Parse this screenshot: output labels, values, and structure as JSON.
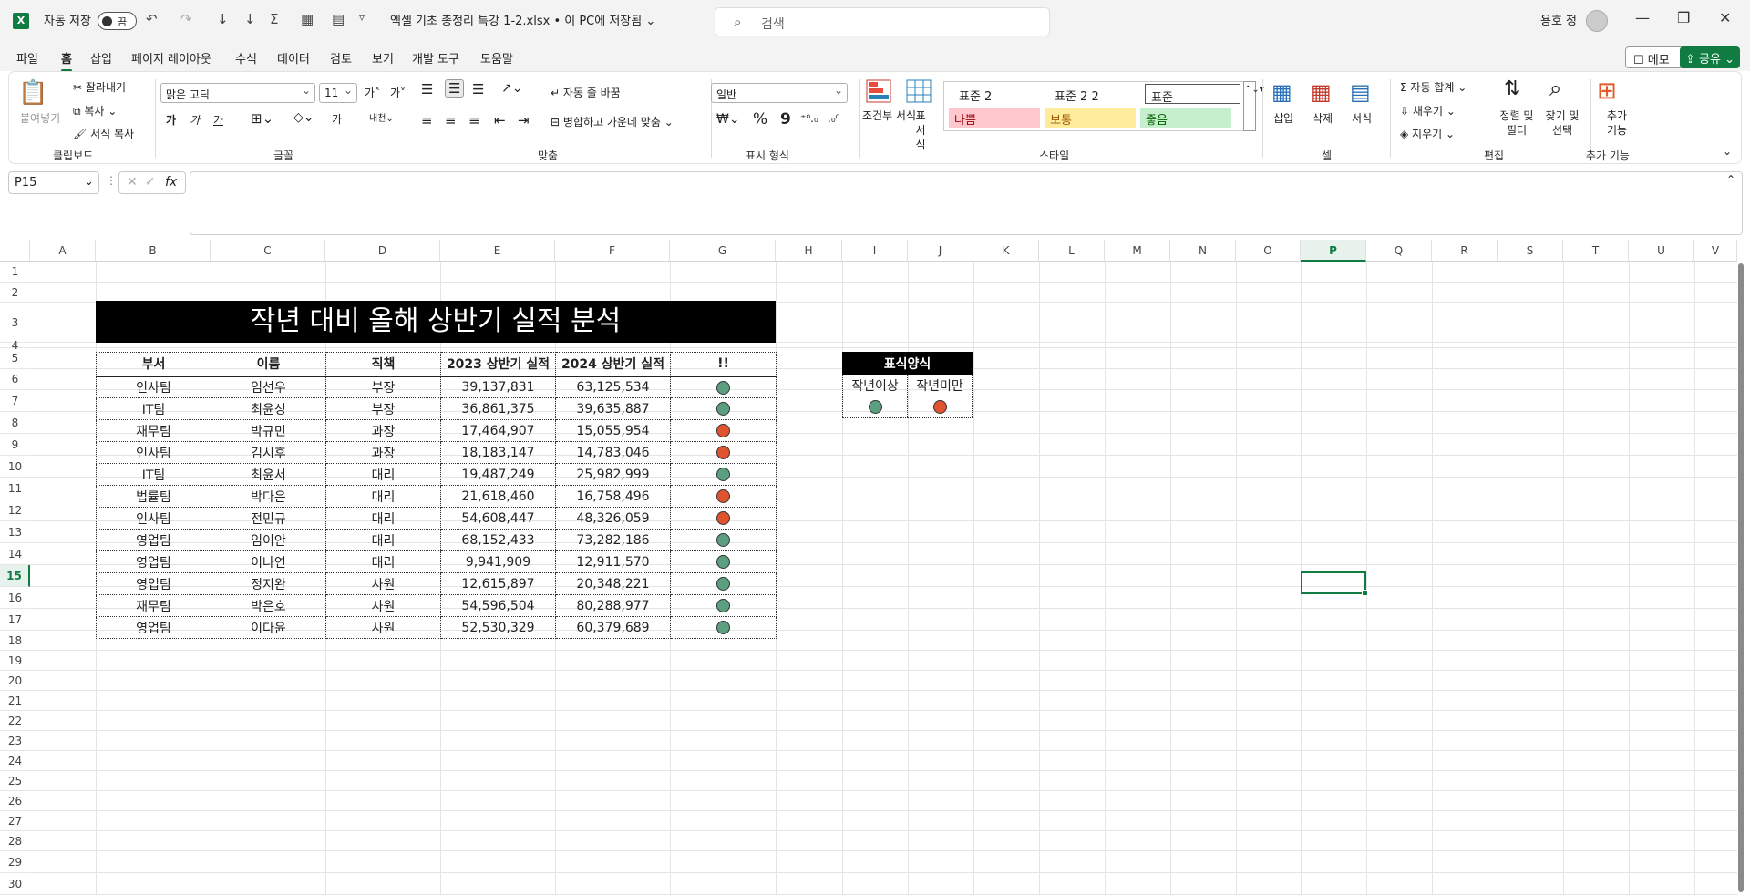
{
  "titlebar": {
    "app_icon": "X",
    "autosave_label": "자동 저장",
    "autosave_state": "끔",
    "filename": "엑셀 기초 총정리 특강 1-2.xlsx • 이 PC에 저장됨 ⌄",
    "search_placeholder": "검색",
    "user_name": "용호 정",
    "qa_undo": "↶",
    "qa_redo": "↷",
    "qa_sort_asc": "↓",
    "qa_sort_desc": "↓",
    "qa_sum": "Σ",
    "qa_more": "▿",
    "win_min": "—",
    "win_restore": "❐",
    "win_close": "✕"
  },
  "menu": {
    "items": [
      "파일",
      "홈",
      "삽입",
      "페이지 레이아웃",
      "수식",
      "데이터",
      "검토",
      "보기",
      "개발 도구",
      "도움말"
    ],
    "active": "홈",
    "memo": "메모",
    "share": "공유"
  },
  "ribbon": {
    "clipboard": {
      "paste": "붙여넣기",
      "cut": "잘라내기",
      "copy": "복사",
      "format_painter": "서식 복사",
      "group": "클립보드"
    },
    "font": {
      "name": "맑은 고딕",
      "size": "11",
      "grow": "가˄",
      "shrink": "가˅",
      "bold": "가",
      "italic": "가",
      "underline": "가",
      "color_a": "가",
      "group": "글꼴"
    },
    "align": {
      "wrap": "자동 줄 바꿈",
      "merge": "병합하고 가운데 맞춤",
      "group": "맞춤"
    },
    "number": {
      "format": "일반",
      "percent": "%",
      "comma": "9",
      "group": "표시 형식"
    },
    "styles": {
      "cond_format": "조건부 서식",
      "table_format": "표 서식",
      "s1": "표준 2",
      "s2": "표준 2 2",
      "s3": "표준",
      "bad": "나쁨",
      "neutral": "보통",
      "good": "좋음",
      "group": "스타일"
    },
    "cells": {
      "insert": "삽입",
      "delete": "삭제",
      "format": "서식",
      "group": "셀"
    },
    "editing": {
      "autosum": "자동 합계",
      "fill": "채우기",
      "clear": "지우기",
      "sort_filter": "정렬 및 필터",
      "find_select": "찾기 및 선택",
      "group": "편집"
    },
    "addins": {
      "label": "추가 기능",
      "group": "추가 기능"
    }
  },
  "formula_bar": {
    "name_box": "P15",
    "fx": "fx",
    "value": ""
  },
  "columns": [
    "A",
    "B",
    "C",
    "D",
    "E",
    "F",
    "G",
    "H",
    "I",
    "J",
    "K",
    "L",
    "M",
    "N",
    "O",
    "P",
    "Q",
    "R",
    "S",
    "T",
    "U",
    "V"
  ],
  "rows": [
    "1",
    "2",
    "3",
    "4",
    "5",
    "6",
    "7",
    "8",
    "9",
    "10",
    "11",
    "12",
    "13",
    "14",
    "15",
    "16",
    "17",
    "18",
    "19",
    "20",
    "21",
    "22",
    "23",
    "24",
    "25",
    "26",
    "27",
    "28",
    "29",
    "30"
  ],
  "sheet": {
    "title": "작년 대비 올해 상반기 실적 분석",
    "headers": [
      "부서",
      "이름",
      "직책",
      "2023 상반기 실적",
      "2024 상반기 실적",
      "!!"
    ],
    "rows": [
      {
        "dept": "인사팀",
        "name": "임선우",
        "pos": "부장",
        "y2023": "39,137,831",
        "y2024": "63,125,534",
        "status": "green"
      },
      {
        "dept": "IT팀",
        "name": "최윤성",
        "pos": "부장",
        "y2023": "36,861,375",
        "y2024": "39,635,887",
        "status": "green"
      },
      {
        "dept": "재무팀",
        "name": "박규민",
        "pos": "과장",
        "y2023": "17,464,907",
        "y2024": "15,055,954",
        "status": "red"
      },
      {
        "dept": "인사팀",
        "name": "김시후",
        "pos": "과장",
        "y2023": "18,183,147",
        "y2024": "14,783,046",
        "status": "red"
      },
      {
        "dept": "IT팀",
        "name": "최윤서",
        "pos": "대리",
        "y2023": "19,487,249",
        "y2024": "25,982,999",
        "status": "green"
      },
      {
        "dept": "법률팀",
        "name": "박다은",
        "pos": "대리",
        "y2023": "21,618,460",
        "y2024": "16,758,496",
        "status": "red"
      },
      {
        "dept": "인사팀",
        "name": "전민규",
        "pos": "대리",
        "y2023": "54,608,447",
        "y2024": "48,326,059",
        "status": "red"
      },
      {
        "dept": "영업팀",
        "name": "임이안",
        "pos": "대리",
        "y2023": "68,152,433",
        "y2024": "73,282,186",
        "status": "green"
      },
      {
        "dept": "영업팀",
        "name": "이나연",
        "pos": "대리",
        "y2023": "9,941,909",
        "y2024": "12,911,570",
        "status": "green"
      },
      {
        "dept": "영업팀",
        "name": "정지완",
        "pos": "사원",
        "y2023": "12,615,897",
        "y2024": "20,348,221",
        "status": "green"
      },
      {
        "dept": "재무팀",
        "name": "박은호",
        "pos": "사원",
        "y2023": "54,596,504",
        "y2024": "80,288,977",
        "status": "green"
      },
      {
        "dept": "영업팀",
        "name": "이다윤",
        "pos": "사원",
        "y2023": "52,530,329",
        "y2024": "60,379,689",
        "status": "green"
      }
    ],
    "legend": {
      "title": "표식양식",
      "above": "작년이상",
      "below": "작년미만"
    }
  },
  "colors": {
    "accent": "#107c41",
    "green_dot": "#5b9f80",
    "red_dot": "#e0532f",
    "bad_bg": "#ffc7ce",
    "neutral_bg": "#ffeb9c",
    "good_bg": "#c6efce"
  }
}
